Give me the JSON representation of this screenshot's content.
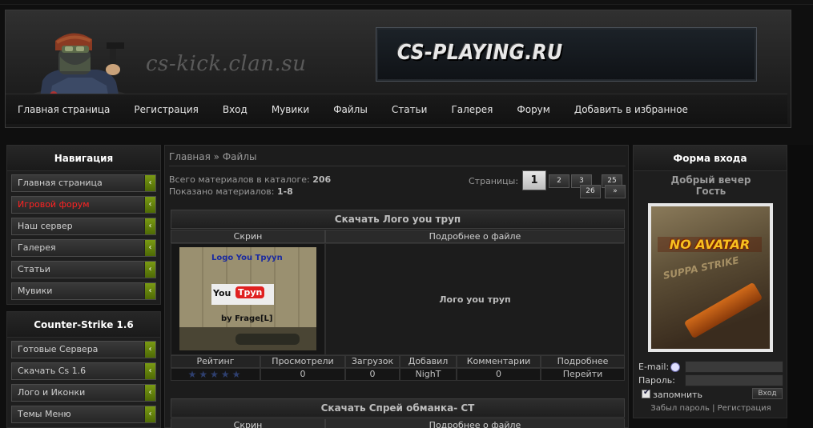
{
  "header": {
    "site_name": "cs-kick.clan.su",
    "banner_text": "CS-PLAYING.RU"
  },
  "menu": [
    "Главная страница",
    "Регистрация",
    "Вход",
    "Мувики",
    "Файлы",
    "Статьи",
    "Галерея",
    "Форум",
    "Добавить в избранное"
  ],
  "nav_block": {
    "title": "Навигация",
    "items": [
      "Главная страница",
      "Игровой форум",
      "Наш сервер",
      "Галерея",
      "Статьи",
      "Мувики"
    ]
  },
  "cs_block": {
    "title": "Counter-Strike 1.6",
    "items": [
      "Готовые Сервера",
      "Скачать Cs 1.6",
      "Лого и Иконки",
      "Темы Меню"
    ]
  },
  "breadcrumb": {
    "home": "Главная",
    "sep": "»",
    "current": "Файлы"
  },
  "stats": {
    "total_label": "Всего материалов в каталоге:",
    "total": "206",
    "shown_label": "Показано материалов:",
    "shown": "1-8"
  },
  "pagination": {
    "label": "Страницы:",
    "pages": [
      "1",
      "2",
      "3",
      "25",
      "26"
    ],
    "next": "»"
  },
  "entries": [
    {
      "title": "Скачать Лого you труп",
      "screen_label": "Скрин",
      "details_label": "Подробнее о файле",
      "description": "Лого you труп",
      "thumb_text": {
        "line1": "Logo You Tpyyn",
        "line2a": "You",
        "line2b": "Tpyn",
        "line3": "by Frage[L]"
      },
      "info_headers": [
        "Рейтинг",
        "Просмотрели",
        "Загрузок",
        "Добавил",
        "Комментарии",
        "Подробнее"
      ],
      "rating_stars": 5,
      "rating_value": 0,
      "views": "0",
      "downloads": "0",
      "author": "NighT",
      "comments": "0",
      "more_link": "Перейти"
    },
    {
      "title": "Скачать Спрей обманка- CT",
      "screen_label": "Скрин",
      "details_label": "Подробнее о файле"
    }
  ],
  "login": {
    "title": "Форма входа",
    "greeting": "Добрый вечер",
    "user": "Гость",
    "avatar_text": "NO AVATAR",
    "avatar_subtext": "SUPPA STRIKE",
    "email_label": "E-mail:",
    "password_label": "Пароль:",
    "remember_label": "запомнить",
    "login_button": "Вход",
    "forgot_link": "Забыл пароль",
    "link_sep": "|",
    "register_link": "Регистрация"
  },
  "colors": {
    "accent_green": "#6a8a0e",
    "highlight_red": "#ff2222"
  }
}
